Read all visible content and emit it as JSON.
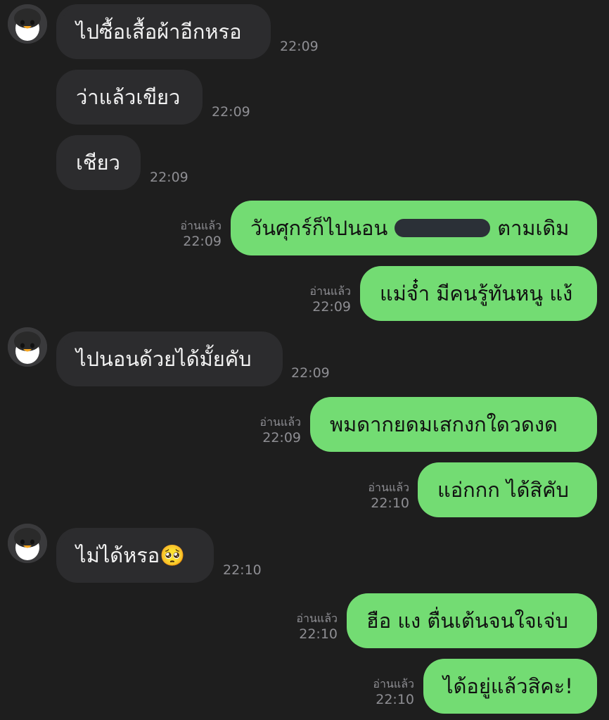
{
  "chat": {
    "read_label": "อ่านแล้ว",
    "avatar_icon": "penguin-icon",
    "messages": [
      {
        "from": "them",
        "text": "ไปซื้อเสื้อผ้าอีกหรอ",
        "time": "22:09"
      },
      {
        "from": "them",
        "text": "ว่าแล้วเขียว",
        "time": "22:09"
      },
      {
        "from": "them",
        "text": "เชียว",
        "time": "22:09"
      },
      {
        "from": "me",
        "text_before": "วันศุกร์ก็ไปนอน",
        "text_after": "ตามเดิม",
        "redacted": true,
        "time": "22:09",
        "read": true
      },
      {
        "from": "me",
        "text": "แม่จ๋ำ มีคนรู้ทันหนู แง้",
        "time": "22:09",
        "read": true
      },
      {
        "from": "them",
        "text": "ไปนอนด้วยได้มั้ยคับ",
        "time": "22:09"
      },
      {
        "from": "me",
        "text": "พมดากยดมเสกงกใดวดงด",
        "time": "22:09",
        "read": true
      },
      {
        "from": "me",
        "text": "แอ่กกก ได้สิคับ",
        "time": "22:10",
        "read": true
      },
      {
        "from": "them",
        "text": "ไม่ได้หรอ🥺",
        "time": "22:10"
      },
      {
        "from": "me",
        "text": "ฮือ แง ตื่นเต้นจนใจเจ่บ",
        "time": "22:10",
        "read": true
      },
      {
        "from": "me",
        "text": "ได้อยู่แล้วสิคะ!",
        "time": "22:10",
        "read": true
      }
    ]
  }
}
